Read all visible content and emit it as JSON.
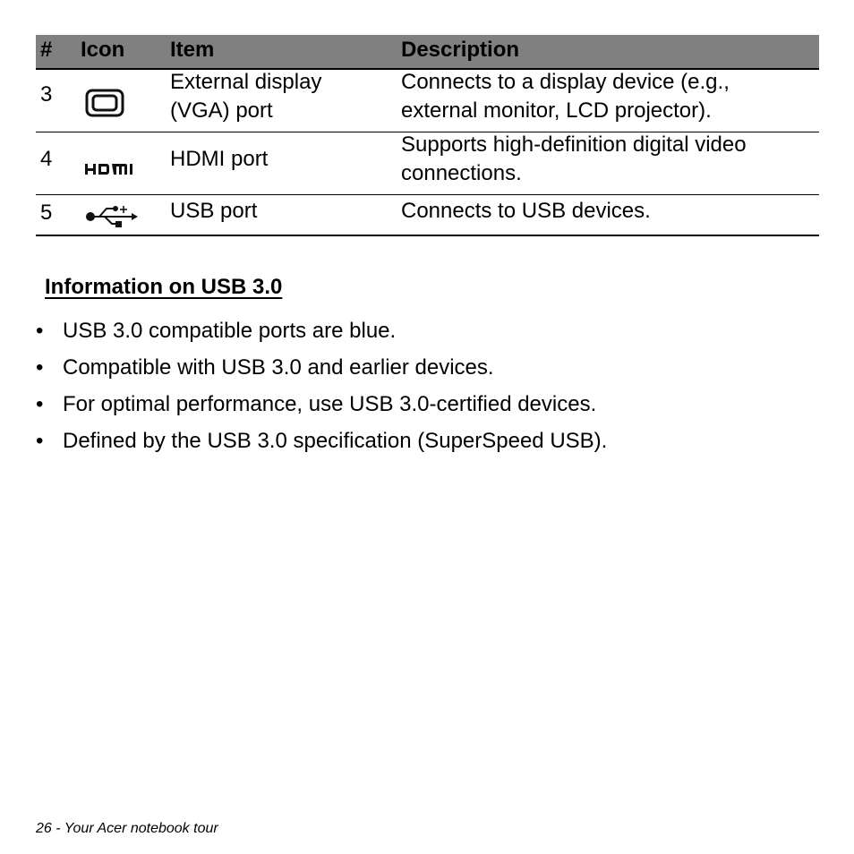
{
  "table": {
    "headers": [
      "#",
      "Icon",
      "Item",
      "Description"
    ],
    "rows": [
      {
        "number": "3",
        "icon": "vga-port-icon",
        "item_lines": [
          "External display",
          "(VGA) port"
        ],
        "description_lines": [
          "Connects to a display device (e.g.,",
          "external monitor, LCD projector)."
        ]
      },
      {
        "number": "4",
        "icon": "hdmi-icon",
        "item_lines": [
          "HDMI port"
        ],
        "description_lines": [
          "Supports high-definition digital video",
          "connections."
        ]
      },
      {
        "number": "5",
        "icon": "usb-icon",
        "item_lines": [
          "USB port"
        ],
        "description_lines": [
          "Connects to USB devices."
        ]
      }
    ]
  },
  "section": {
    "heading": "Information on USB 3.0",
    "bullet_glyph": "•",
    "bullets": [
      "USB 3.0 compatible ports are blue.",
      "Compatible with USB 3.0 and earlier devices.",
      "For optimal performance, use USB 3.0-certified devices.",
      "Defined by the USB 3.0 specification (SuperSpeed USB)."
    ]
  },
  "footer": {
    "text": "26 - Your Acer notebook tour"
  },
  "colors": {
    "header_bg": "#808080"
  }
}
